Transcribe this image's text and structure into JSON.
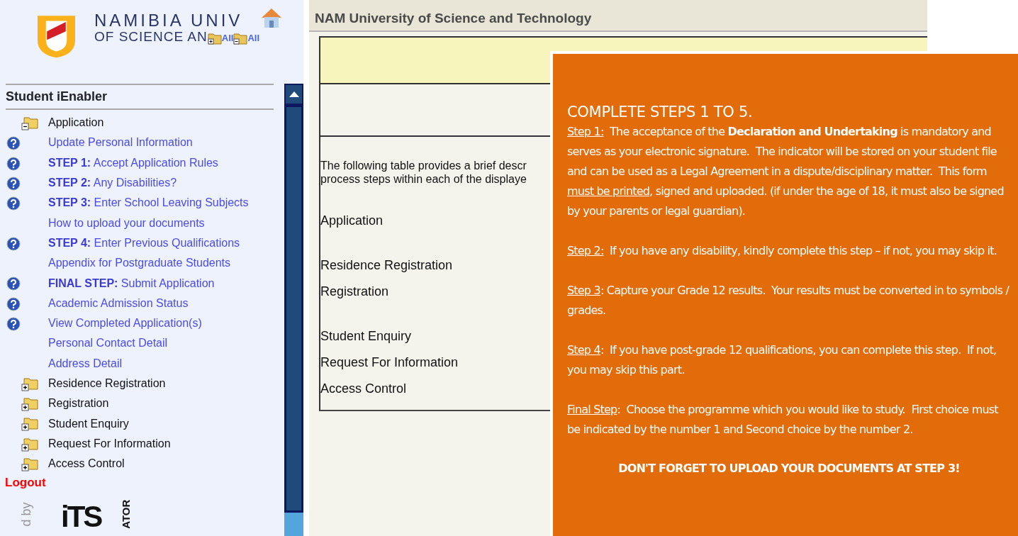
{
  "logo": {
    "line_1": "NAMIBIA UNIV",
    "line_2": "OF SCIENCE AN",
    "links": [
      "All",
      "All"
    ]
  },
  "sidebar": {
    "title": "Student iEnabler",
    "tree": [
      {
        "label": "Application",
        "expanded": true,
        "children": [
          {
            "label": "Update Personal Information",
            "help": true
          },
          {
            "label": "**STEP 1:** Accept Application Rules",
            "help": true
          },
          {
            "label": "**STEP 2:** Any Disabilities?",
            "help": true
          },
          {
            "label": "**STEP 3:** Enter School Leaving Subjects",
            "help": true
          },
          {
            "label": "How to upload your documents",
            "help": false
          },
          {
            "label": "**STEP 4:** Enter Previous Qualifications",
            "help": true
          },
          {
            "label": "Appendix for Postgraduate Students",
            "help": false
          },
          {
            "label": "**FINAL STEP:** Submit Application",
            "help": true
          },
          {
            "label": "Academic Admission Status",
            "help": true
          },
          {
            "label": "View Completed Application(s)",
            "help": true
          },
          {
            "label": "Personal Contact Detail",
            "help": false
          },
          {
            "label": "Address Detail",
            "help": false
          }
        ]
      },
      {
        "label": "Residence Registration",
        "expanded": false
      },
      {
        "label": "Registration",
        "expanded": false
      },
      {
        "label": "Student Enquiry",
        "expanded": false
      },
      {
        "label": "Request For Information",
        "expanded": false
      },
      {
        "label": "Access Control",
        "expanded": false
      }
    ],
    "logout": "Logout"
  },
  "powered_by": {
    "caption": "d by",
    "brand": "iTS",
    "brand_side": "ATOR"
  },
  "main": {
    "title": "NAM University of Science and Technology",
    "intro": [
      "The following table provides a brief descr",
      "process steps within each of the displaye"
    ],
    "sections": [
      "Application",
      "Residence Registration",
      "Registration",
      "Student Enquiry",
      "Request For Information",
      "Access Control"
    ]
  },
  "notice": {
    "heading": "COMPLETE STEPS 1 TO 5.",
    "paragraphs": [
      [
        {
          "text": "Step 1:",
          "kind": "underline"
        },
        {
          "text": "  The acceptance of the ",
          "kind": "plain"
        },
        {
          "text": "Declaration and Undertaking",
          "kind": "bold"
        },
        {
          "text": " is mandatory and serves as your electronic signature.  The indicator will be stored on your student file and can be used as a Legal Agreement in a dispute/disciplinary matter.  This form ",
          "kind": "plain"
        },
        {
          "text": "must be printed",
          "kind": "underline"
        },
        {
          "text": ", signed and uploaded. (if under the age of 18, it must also be signed by your parents or legal guardian).",
          "kind": "plain"
        }
      ],
      [
        {
          "text": "Step 2:",
          "kind": "underline"
        },
        {
          "text": "  If you have any disability, kindly complete this step – if not, you may skip it.",
          "kind": "plain"
        }
      ],
      [
        {
          "text": "Step 3",
          "kind": "underline"
        },
        {
          "text": ": Capture your Grade 12 results.  Your results must be converted in to symbols / grades.",
          "kind": "plain"
        }
      ],
      [
        {
          "text": "Step 4",
          "kind": "underline"
        },
        {
          "text": ":  If you have post-grade 12 qualifications, you can complete this step.  If not, you may skip this part.",
          "kind": "plain"
        }
      ],
      [
        {
          "text": "Final Step",
          "kind": "underline"
        },
        {
          "text": ":  Choose the programme which you would like to study.  First choice must be indicated by the number 1 and Second choice by the number 2.",
          "kind": "plain"
        }
      ]
    ],
    "footer": "DON'T FORGET TO UPLOAD YOUR DOCUMENTS AT STEP 3!"
  }
}
